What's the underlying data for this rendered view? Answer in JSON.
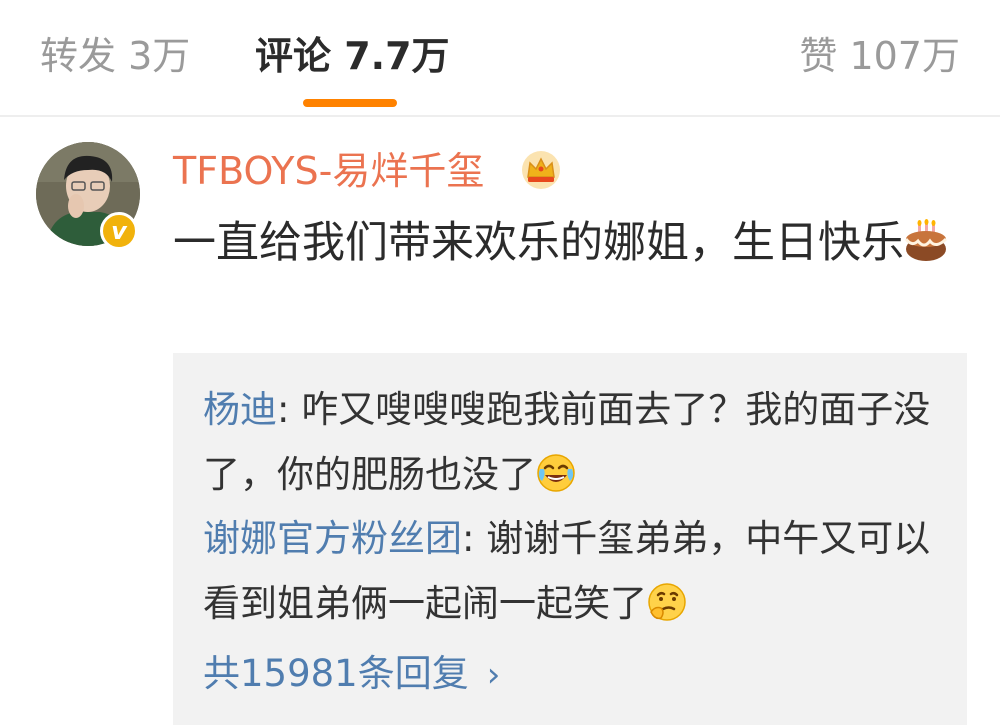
{
  "tabs": {
    "repost": "转发 3万",
    "comment": "评论 7.7万",
    "like": "赞 107万",
    "accent_color": "#ff8200"
  },
  "comment": {
    "username": "TFBOYS-易烊千玺",
    "username_color": "#eb7350",
    "text": "一直给我们带来欢乐的娜姐，生日快乐",
    "badge_icon": "crown-icon",
    "verified_icon": "verified-v-icon",
    "trailing_emoji": "cake-icon"
  },
  "replies": [
    {
      "author": "杨迪",
      "separator": ": ",
      "text": "咋又嗖嗖嗖跑我前面去了？我的面子没了，你的肥肠也没了",
      "emoji": "laughing-tears-icon"
    },
    {
      "author": "谢娜官方粉丝团",
      "separator": ": ",
      "text": "谢谢千玺弟弟，中午又可以看到姐弟俩一起闹一起笑了",
      "emoji": "thinking-face-icon"
    }
  ],
  "more_replies": "共15981条回复",
  "link_color": "#507daf"
}
